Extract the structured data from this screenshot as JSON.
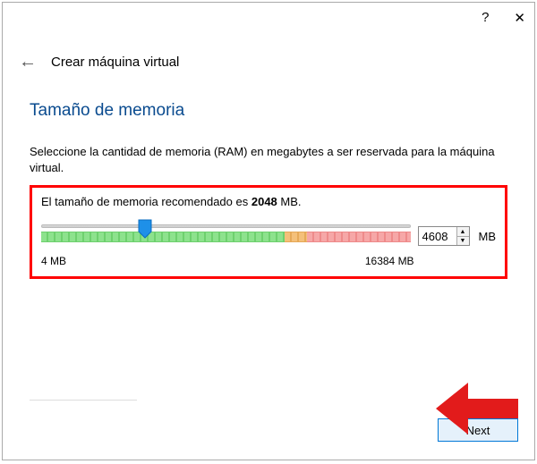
{
  "titlebar": {
    "help": "?",
    "close": "✕"
  },
  "header": {
    "back": "←",
    "title": "Crear máquina virtual"
  },
  "section": {
    "title": "Tamaño de memoria",
    "desc": "Seleccione la cantidad de memoria (RAM) en megabytes a ser reservada para la máquina virtual.",
    "reco_pre": "El tamaño de memoria recomendado es ",
    "reco_val": "2048",
    "reco_post": " MB."
  },
  "slider": {
    "min_label": "4 MB",
    "max_label": "16384 MB",
    "value": "4608",
    "unit": "MB"
  },
  "buttons": {
    "next": "Next"
  },
  "chart_data": {
    "type": "bar",
    "title": "Memory size slider",
    "min": 4,
    "max": 16384,
    "recommended": 2048,
    "value": 4608,
    "unit": "MB"
  }
}
